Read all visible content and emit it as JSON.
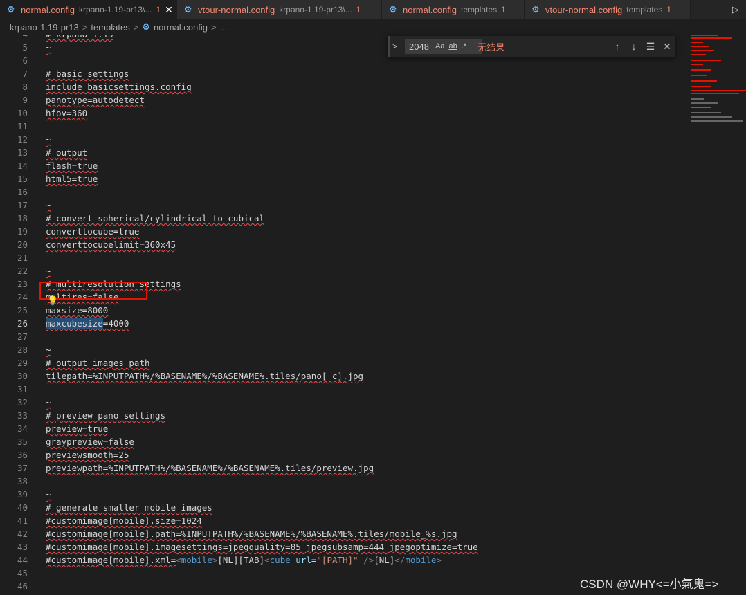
{
  "tabs": [
    {
      "name": "normal.config",
      "desc": "krpano-1.19-pr13\\...",
      "count": "1",
      "active": true
    },
    {
      "name": "vtour-normal.config",
      "desc": "krpano-1.19-pr13\\...",
      "count": "1",
      "active": false
    },
    {
      "name": "normal.config",
      "desc": "templates",
      "count": "1",
      "active": false
    },
    {
      "name": "vtour-normal.config",
      "desc": "templates",
      "count": "1",
      "active": false
    }
  ],
  "tab_actions": {
    "run_icon": "play-icon",
    "run": "▷"
  },
  "close_glyph": "✕",
  "breadcrumb": {
    "part1": "krpano-1.19-pr13",
    "part2": "templates",
    "part3": "normal.config",
    "part4": "...",
    "sep": ">"
  },
  "find": {
    "value": "2048",
    "match_case": "Aa",
    "whole_word": "ab",
    "regex": ".*",
    "no_results": "无结果",
    "prev": "↑",
    "next": "↓",
    "selection": "☰",
    "close": "✕",
    "toggle": ">"
  },
  "lines": [
    {
      "n": "4",
      "text": "# krpano 1.19"
    },
    {
      "n": "5",
      "text": "~"
    },
    {
      "n": "6",
      "text": ""
    },
    {
      "n": "7",
      "text": "# basic settings"
    },
    {
      "n": "8",
      "text": "include basicsettings.config"
    },
    {
      "n": "9",
      "text": "panotype=autodetect"
    },
    {
      "n": "10",
      "text": "hfov=360"
    },
    {
      "n": "11",
      "text": ""
    },
    {
      "n": "12",
      "text": "~"
    },
    {
      "n": "13",
      "text": "# output"
    },
    {
      "n": "14",
      "text": "flash=true"
    },
    {
      "n": "15",
      "text": "html5=true"
    },
    {
      "n": "16",
      "text": ""
    },
    {
      "n": "17",
      "text": "~"
    },
    {
      "n": "18",
      "text": "# convert spherical/cylindrical to cubical"
    },
    {
      "n": "19",
      "text": "converttocube=true"
    },
    {
      "n": "20",
      "text": "converttocubelimit=360x45"
    },
    {
      "n": "21",
      "text": ""
    },
    {
      "n": "22",
      "text": "~"
    },
    {
      "n": "23",
      "text": "# multiresolution settings"
    },
    {
      "n": "24",
      "text": "multires=false"
    },
    {
      "n": "25",
      "text": "maxsize=8000"
    },
    {
      "n": "26",
      "text": "=4000",
      "hl": "maxcubesize"
    },
    {
      "n": "27",
      "text": ""
    },
    {
      "n": "28",
      "text": "~"
    },
    {
      "n": "29",
      "text": "# output images path"
    },
    {
      "n": "30",
      "text": "tilepath=%INPUTPATH%/%BASENAME%/%BASENAME%.tiles/pano[_c].jpg"
    },
    {
      "n": "31",
      "text": ""
    },
    {
      "n": "32",
      "text": "~"
    },
    {
      "n": "33",
      "text": "# preview pano settings"
    },
    {
      "n": "34",
      "text": "preview=true"
    },
    {
      "n": "35",
      "text": "graypreview=false"
    },
    {
      "n": "36",
      "text": "previewsmooth=25"
    },
    {
      "n": "37",
      "text": "previewpath=%INPUTPATH%/%BASENAME%/%BASENAME%.tiles/preview.jpg"
    },
    {
      "n": "38",
      "text": ""
    },
    {
      "n": "39",
      "text": "~"
    },
    {
      "n": "40",
      "text": "# generate smaller mobile images"
    },
    {
      "n": "41",
      "text": "#customimage[mobile].size=1024"
    },
    {
      "n": "42",
      "text": "#customimage[mobile].path=%INPUTPATH%/%BASENAME%/%BASENAME%.tiles/mobile_%s.jpg"
    },
    {
      "n": "43",
      "text": "#customimage[mobile].imagesettings=jpegquality=85 jpegsubsamp=444 jpegoptimize=true"
    },
    {
      "n": "44",
      "text": "#customimage[mobile].xml=",
      "xml": true
    },
    {
      "n": "45",
      "text": ""
    },
    {
      "n": "46",
      "text": ""
    }
  ],
  "xml_tail": {
    "t1": "<",
    "t2": "mobile",
    "t3": ">",
    "t4": "[NL][TAB]",
    "t5": "<",
    "t6": "cube",
    "t7": " ",
    "t8": "url",
    "t9": "=",
    "t10": "\"[PATH]\"",
    "t11": " />",
    "t12": "[NL]",
    "t13": "</",
    "t14": "mobile",
    "t15": ">"
  },
  "bulb_icon": "lightbulb-icon",
  "watermark": "CSDN @WHY<=小氣鬼=>",
  "colors": {
    "accent": "#75beff",
    "error": "#f14c4c",
    "highlight_box": "#e51400"
  }
}
